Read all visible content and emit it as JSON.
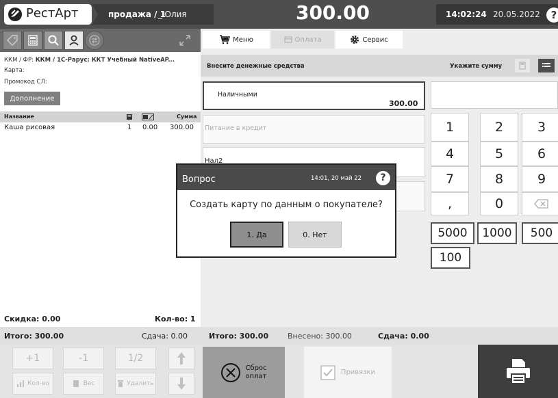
{
  "header": {
    "logo_text": "РестАрт",
    "mode": "продажа / 1",
    "user": "_Юлия",
    "total": "300.00",
    "time": "14:02:24",
    "date": "20.05.2022",
    "help": "?"
  },
  "left": {
    "kkm_label": "ККМ / ФР: ",
    "kkm_value": "ККМ / 1С-Рарус: ККТ Учебный NativeAP...",
    "card": "Карта:",
    "promo": "Промокод СЛ:",
    "add_button": "Дополнение",
    "columns": [
      "Название",
      "Сумма"
    ],
    "items": [
      {
        "name": "Каша рисовая",
        "qty": "1",
        "discount": "0.00",
        "sum": "300.00"
      }
    ],
    "discount": "Скидка: 0.00",
    "count": "Кол-во: 1",
    "total": "Итого: 300.00",
    "change": "Сдача: 0.00",
    "buttons": {
      "plus": "+1",
      "minus": "-1",
      "half": "1/2",
      "qty": "Кол-во",
      "weight": "Вес",
      "delete": "Удалить"
    }
  },
  "menu": {
    "menu": "Меню",
    "payment": "Оплата",
    "service": "Сервис"
  },
  "payment": {
    "prompt": "Внесите денежные средства",
    "amount_prompt": "Укажите сумму",
    "cash_label": "Наличными",
    "cash_value": "300.00",
    "credit": "Питание в кредит",
    "nal2": "Нал2"
  },
  "keypad": {
    "digits": [
      "1",
      "2",
      "3",
      "4",
      "5",
      "6",
      "7",
      "8",
      "9",
      ",",
      "0"
    ],
    "quick": [
      "5000",
      "1000",
      "500",
      "100"
    ]
  },
  "footer": {
    "total": "Итого: 300.00",
    "paid": "Внесено: 300.00",
    "change": "Сдача: 0.00",
    "reset": "Сброс оплат",
    "reset_line1": "Сброс",
    "reset_line2": "оплат",
    "binding": "Привязки"
  },
  "dialog": {
    "title": "Вопрос",
    "time": "14:01, 20 май 22",
    "help": "?",
    "question": "Создать карту по данным о покупателе?",
    "yes": "1. Да",
    "no": "0. Нет"
  },
  "colors": {
    "header": "#4e4e4e",
    "dialog_header": "#4a4a4a",
    "print_button": "#3e3e3e"
  }
}
